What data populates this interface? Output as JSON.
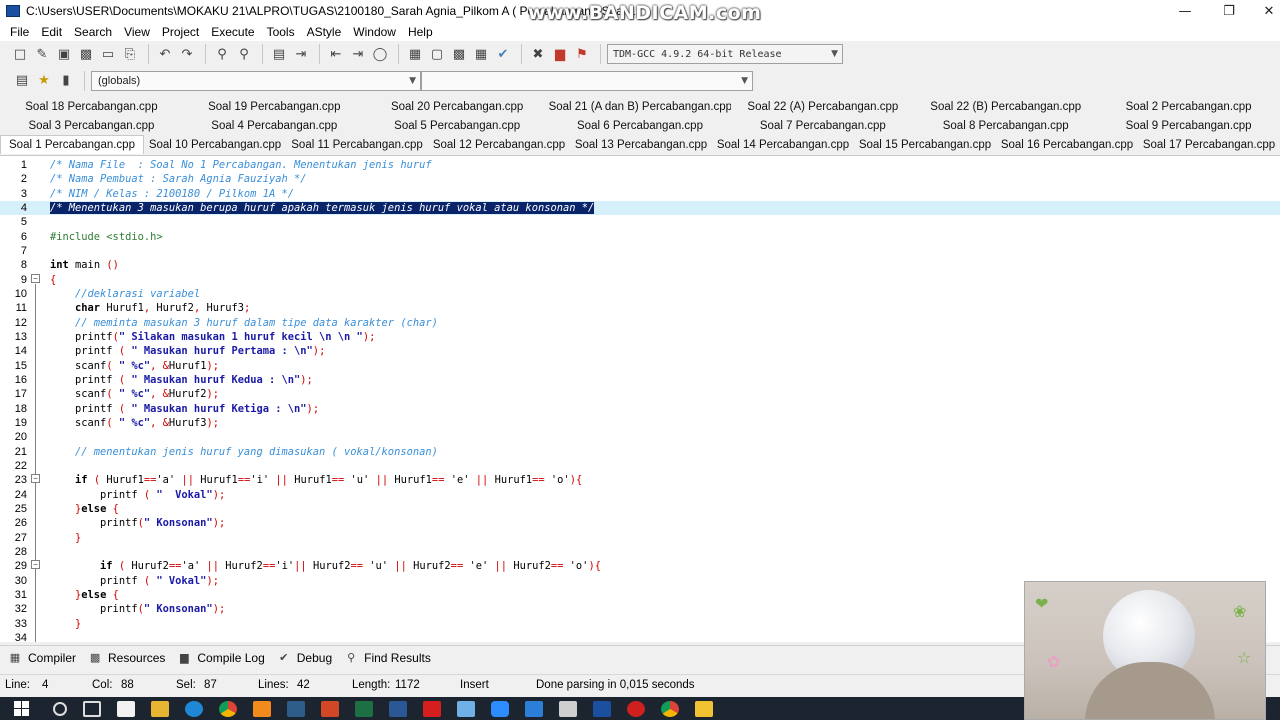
{
  "window": {
    "title": "C:\\Users\\USER\\Documents\\MOKAKU 21\\ALPRO\\TUGAS\\2100180_Sarah Agnia_Pilkom A ( Percabangan )\\Soal 1",
    "watermark": "www.BANDICAM.com",
    "controls": [
      "minimize",
      "maximize",
      "close"
    ]
  },
  "menu": [
    "File",
    "Edit",
    "Search",
    "View",
    "Project",
    "Execute",
    "Tools",
    "AStyle",
    "Window",
    "Help"
  ],
  "toolbar": {
    "compiler": "TDM-GCC 4.9.2 64-bit Release",
    "scope": "(globals)",
    "symbol": ""
  },
  "tabs": {
    "row1": [
      "Soal 18 Percabangan.cpp",
      "Soal 19 Percabangan.cpp",
      "Soal 20 Percabangan.cpp",
      "Soal 21 (A dan B) Percabangan.cpp",
      "Soal 22 (A) Percabangan.cpp",
      "Soal 22 (B) Percabangan.cpp",
      "Soal 2 Percabangan.cpp"
    ],
    "row2": [
      "Soal 3 Percabangan.cpp",
      "Soal 4 Percabangan.cpp",
      "Soal 5 Percabangan.cpp",
      "Soal 6 Percabangan.cpp",
      "Soal 7 Percabangan.cpp",
      "Soal 8 Percabangan.cpp",
      "Soal 9 Percabangan.cpp"
    ],
    "row3": [
      "Soal 1 Percabangan.cpp",
      "Soal 10 Percabangan.cpp",
      "Soal 11 Percabangan.cpp",
      "Soal 12 Percabangan.cpp",
      "Soal 13 Percabangan.cpp",
      "Soal 14 Percabangan.cpp",
      "Soal 15 Percabangan.cpp",
      "Soal 16 Percabangan.cpp",
      "Soal 17 Percabangan.cpp"
    ],
    "active": "Soal 1 Percabangan.cpp"
  },
  "code": [
    {
      "n": "1",
      "t": "/* Nama File  : Soal No 1 Percabangan. Menentukan jenis huruf",
      "k": "comment"
    },
    {
      "n": "2",
      "t": "/* Nama Pembuat : Sarah Agnia Fauziyah */",
      "k": "comment"
    },
    {
      "n": "3",
      "t": "/* NIM / Kelas : 2100180 / Pilkom 1A */",
      "k": "comment"
    },
    {
      "n": "4",
      "t": "/* Menentukan 3 masukan berupa huruf apakah termasuk jenis huruf vokal atau konsonan */",
      "k": "selected"
    },
    {
      "n": "5",
      "t": "",
      "k": "plain"
    },
    {
      "n": "6",
      "t": "#include <stdio.h>",
      "k": "pp"
    },
    {
      "n": "7",
      "t": "",
      "k": "plain"
    },
    {
      "n": "8",
      "t": "int main ()",
      "k": "kwline"
    },
    {
      "n": "9",
      "t": "{",
      "k": "sym"
    },
    {
      "n": "10",
      "t": "    //deklarasi variabel",
      "k": "comment"
    },
    {
      "n": "11",
      "t": "    char Huruf1, Huruf2, Huruf3;",
      "k": "decl"
    },
    {
      "n": "12",
      "t": "    // meminta masukan 3 huruf dalam tipe data karakter (char)",
      "k": "comment"
    },
    {
      "n": "13",
      "t": "    printf(\" Silakan masukan 1 huruf kecil \\n \\n \");",
      "k": "call"
    },
    {
      "n": "14",
      "t": "    printf ( \" Masukan huruf Pertama : \\n\");",
      "k": "call"
    },
    {
      "n": "15",
      "t": "    scanf( \" %c\", &Huruf1);",
      "k": "call"
    },
    {
      "n": "16",
      "t": "    printf ( \" Masukan huruf Kedua : \\n\");",
      "k": "call"
    },
    {
      "n": "17",
      "t": "    scanf( \" %c\", &Huruf2);",
      "k": "call"
    },
    {
      "n": "18",
      "t": "    printf ( \" Masukan huruf Ketiga : \\n\");",
      "k": "call"
    },
    {
      "n": "19",
      "t": "    scanf( \" %c\", &Huruf3);",
      "k": "call"
    },
    {
      "n": "20",
      "t": "",
      "k": "plain"
    },
    {
      "n": "21",
      "t": "    // menentukan jenis huruf yang dimasukan ( vokal/konsonan)",
      "k": "comment"
    },
    {
      "n": "22",
      "t": "",
      "k": "plain"
    },
    {
      "n": "23",
      "t": "    if ( Huruf1=='a' || Huruf1=='i' || Huruf1== 'u' || Huruf1== 'e' || Huruf1== 'o'){",
      "k": "cond"
    },
    {
      "n": "24",
      "t": "        printf ( \"  Vokal\");",
      "k": "call"
    },
    {
      "n": "25",
      "t": "    }else {",
      "k": "else"
    },
    {
      "n": "26",
      "t": "        printf(\" Konsonan\");",
      "k": "call"
    },
    {
      "n": "27",
      "t": "    }",
      "k": "sym"
    },
    {
      "n": "28",
      "t": "",
      "k": "plain"
    },
    {
      "n": "29",
      "t": "        if ( Huruf2=='a' || Huruf2=='i'|| Huruf2== 'u' || Huruf2== 'e' || Huruf2== 'o'){",
      "k": "cond"
    },
    {
      "n": "30",
      "t": "        printf ( \" Vokal\");",
      "k": "call"
    },
    {
      "n": "31",
      "t": "    }else {",
      "k": "else"
    },
    {
      "n": "32",
      "t": "        printf(\" Konsonan\");",
      "k": "call"
    },
    {
      "n": "33",
      "t": "    }",
      "k": "sym"
    },
    {
      "n": "34",
      "t": "",
      "k": "plain"
    }
  ],
  "bottom_tabs": [
    "Compiler",
    "Resources",
    "Compile Log",
    "Debug",
    "Find Results"
  ],
  "status": {
    "line_label": "Line:",
    "line": "4",
    "col_label": "Col:",
    "col": "88",
    "sel_label": "Sel:",
    "sel": "87",
    "lines_label": "Lines:",
    "lines": "42",
    "length_label": "Length:",
    "length": "1172",
    "mode": "Insert",
    "message": "Done parsing in 0,015 seconds"
  },
  "colors": {
    "comment": "#3a8fd8",
    "preprocessor": "#2e7d32",
    "string": "#1a1aa6",
    "symbol": "#d00000",
    "selection": "#0a246a",
    "current_line": "#d6f0fb",
    "taskbar": "#1c2430"
  },
  "taskbar": {
    "icons": [
      "windows-start-icon",
      "search-icon",
      "task-view-icon",
      "store-icon",
      "file-explorer-icon",
      "edge-icon",
      "chrome-icon",
      "sublime-icon",
      "devcpp-icon",
      "powerpoint-icon",
      "excel-icon",
      "word-icon",
      "acrobat-icon",
      "folder-icon",
      "zoom-icon",
      "vscode-icon",
      "bandicam-icon",
      "devcpp-task-icon",
      "record-icon",
      "chrome2-icon",
      "taskbar-app-icon"
    ]
  }
}
